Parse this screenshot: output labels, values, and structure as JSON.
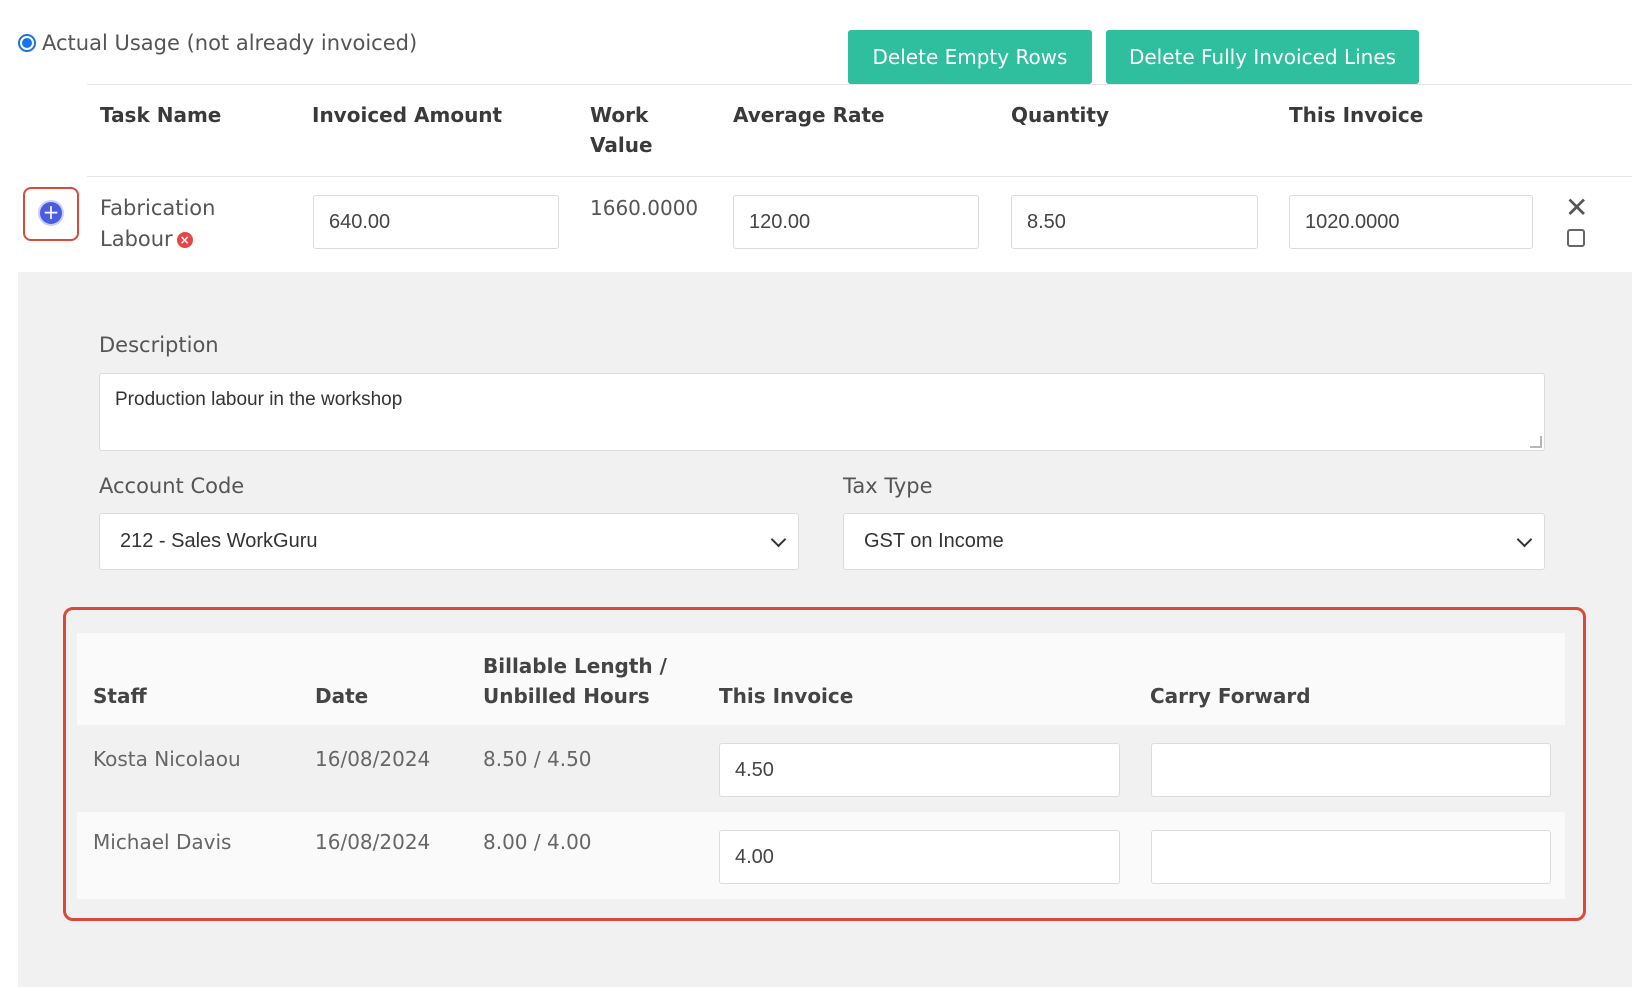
{
  "top": {
    "radio_label": "Actual Usage (not already invoiced)",
    "delete_empty_label": "Delete Empty Rows",
    "delete_fully_label": "Delete Fully Invoiced Lines"
  },
  "table": {
    "headers": {
      "task_name": "Task Name",
      "invoiced_amount": "Invoiced Amount",
      "work_value_line1": "Work",
      "work_value_line2": "Value",
      "average_rate": "Average Rate",
      "quantity": "Quantity",
      "this_invoice": "This Invoice"
    },
    "row": {
      "task_line1": "Fabrication",
      "task_line2": "Labour",
      "invoiced_amount": "640.00",
      "work_value": "1660.0000",
      "average_rate": "120.00",
      "quantity": "8.50",
      "this_invoice": "1020.0000"
    }
  },
  "details": {
    "description_label": "Description",
    "description_value": "Production labour in the workshop",
    "account_code_label": "Account Code",
    "account_code_value": "212 - Sales WorkGuru",
    "tax_type_label": "Tax Type",
    "tax_type_value": "GST on Income"
  },
  "staff_table": {
    "headers": {
      "staff": "Staff",
      "date": "Date",
      "billable_line1": "Billable Length /",
      "billable_line2": "Unbilled Hours",
      "this_invoice": "This Invoice",
      "carry_forward": "Carry Forward"
    },
    "rows": [
      {
        "staff": "Kosta Nicolaou",
        "date": "16/08/2024",
        "hours": "8.50 / 4.50",
        "this_invoice": "4.50",
        "carry_forward": ""
      },
      {
        "staff": "Michael Davis",
        "date": "16/08/2024",
        "hours": "8.00 / 4.00",
        "this_invoice": "4.00",
        "carry_forward": ""
      }
    ]
  },
  "colors": {
    "button": "#2fbf9e",
    "highlight": "#d94a3a",
    "plus_icon": "#4a5de0",
    "radio": "#1a73e8"
  }
}
